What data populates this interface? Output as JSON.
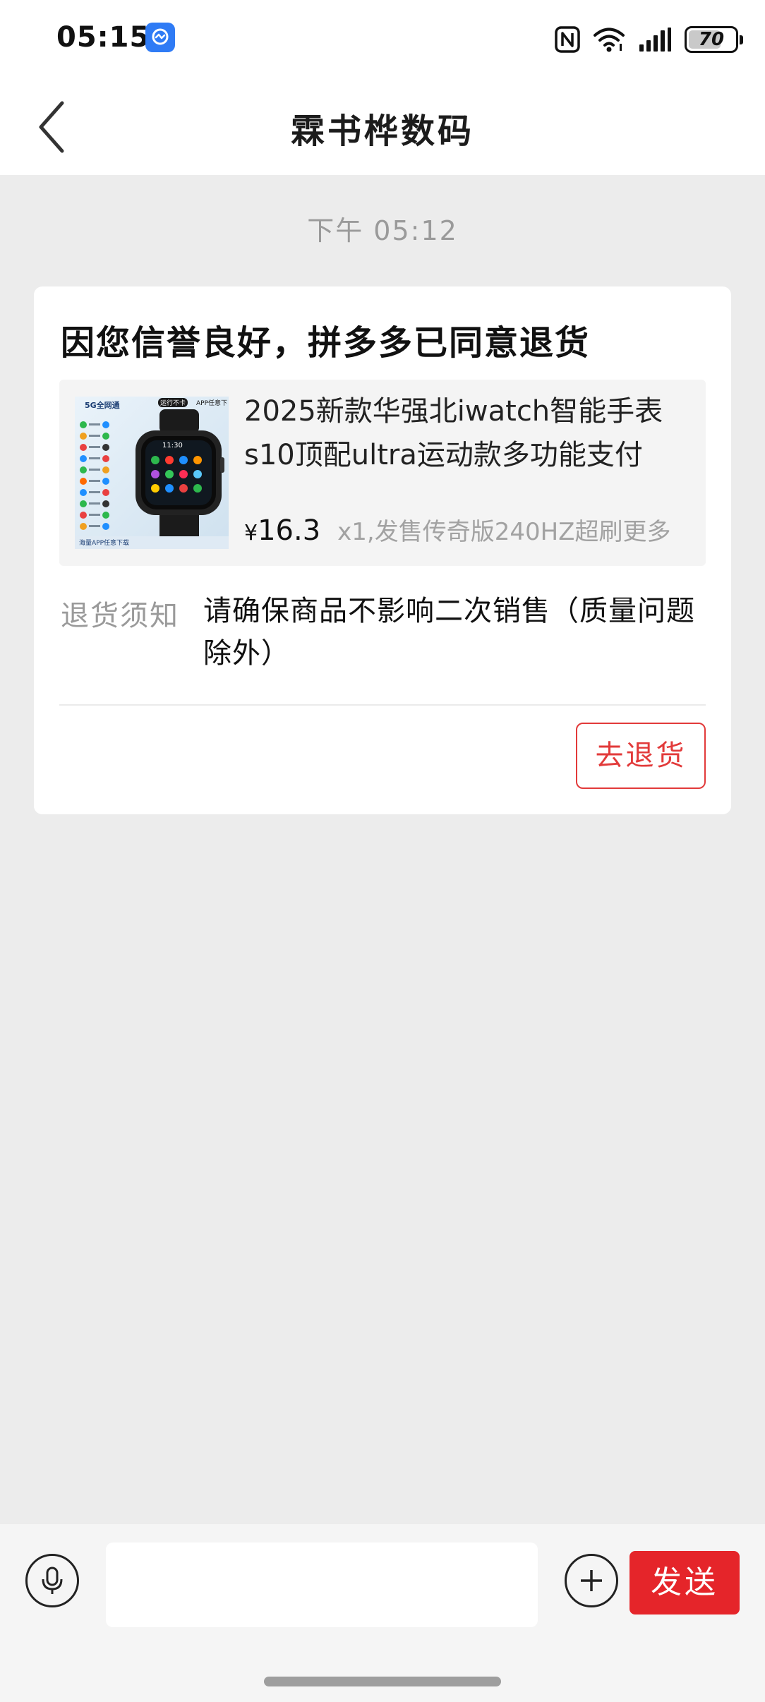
{
  "status_bar": {
    "time": "05:15",
    "app_icon": "messenger-app-icon",
    "nfc_icon": "nfc-icon",
    "wifi_icon": "wifi-icon",
    "signal_icon": "signal-icon",
    "battery_level": "70",
    "battery_fraction": 0.7
  },
  "header": {
    "title": "霖书桦数码",
    "back_icon": "chevron-left-icon"
  },
  "chat": {
    "timestamp": "下午 05:12"
  },
  "card": {
    "title": "因您信誉良好，拼多多已同意退货",
    "product": {
      "name": "2025新款华强北iwatch智能手表s10顶配ultra运动款多功能支付",
      "price_symbol": "¥",
      "price": "16.3",
      "spec": "x1,发售传奇版240HZ超刷更多",
      "image_text": {
        "badge": "5G全网通",
        "top": "运行不卡",
        "top2": "APP任意下",
        "footer": "海量APP任意下载",
        "watch_time": "11:30"
      }
    },
    "notice_label": "退货须知",
    "notice_text": "请确保商品不影响二次销售（质量问题除外）",
    "return_button": "去退货"
  },
  "composer": {
    "voice_icon": "microphone-icon",
    "input_value": "",
    "input_placeholder": "",
    "plus_icon": "plus-icon",
    "send_label": "发送"
  },
  "colors": {
    "accent_red": "#e5252a",
    "background": "#ececec",
    "card": "#ffffff"
  }
}
